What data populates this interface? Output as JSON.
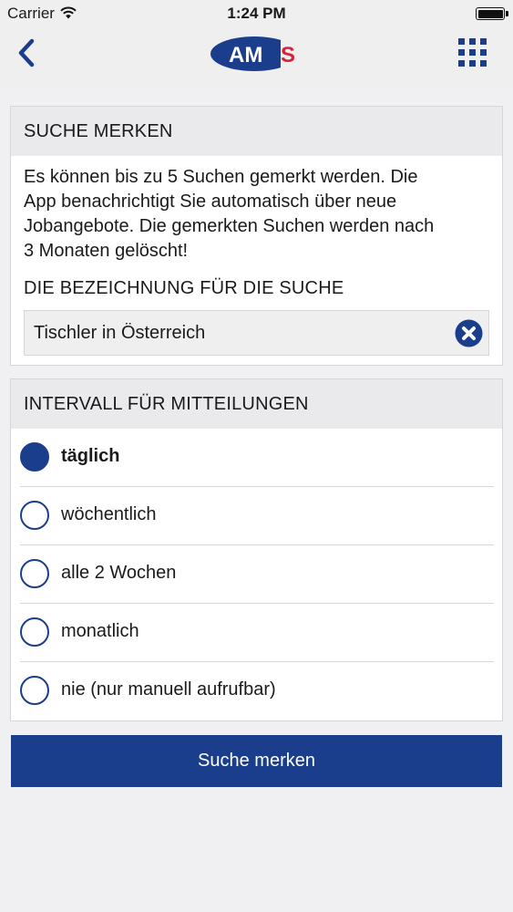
{
  "status_bar": {
    "carrier": "Carrier",
    "time": "1:24 PM"
  },
  "nav": {
    "back_icon": "chevron-left-icon",
    "menu_icon": "grid-icon",
    "logo_text": "AMS",
    "brand_blue": "#1a3e8c",
    "brand_red": "#d9233a"
  },
  "save_search": {
    "header": "SUCHE MERKEN",
    "info_lines": [
      "Es können bis zu 5 Suchen gemerkt werden. Die",
      "App benachrichtigt Sie automatisch über neue",
      "Jobangebote. Die gemerkten Suchen werden nach",
      "3 Monaten gelöscht!"
    ],
    "name_label": "DIE BEZEICHNUNG FÜR DIE SUCHE",
    "name_value": "Tischler in Österreich",
    "clear_icon": "clear-x-circle-icon"
  },
  "interval": {
    "header": "INTERVALL FÜR MITTEILUNGEN",
    "options": [
      {
        "label": "täglich",
        "selected": true
      },
      {
        "label": "wöchentlich",
        "selected": false
      },
      {
        "label": "alle 2 Wochen",
        "selected": false
      },
      {
        "label": "monatlich",
        "selected": false
      },
      {
        "label": "nie (nur manuell aufrufbar)",
        "selected": false
      }
    ]
  },
  "submit_label": "Suche merken"
}
